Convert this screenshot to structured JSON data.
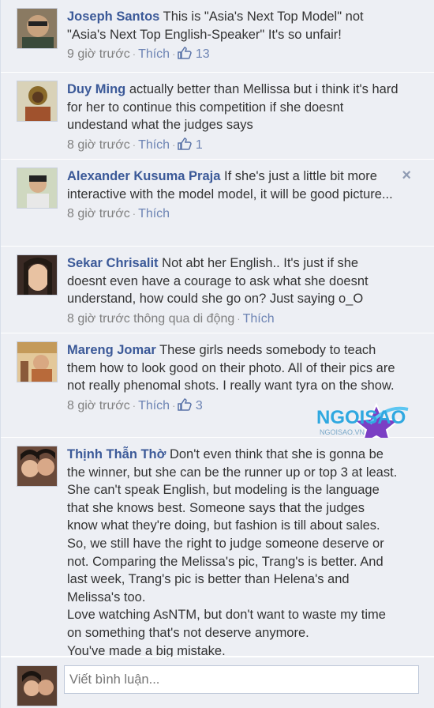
{
  "comments": [
    {
      "author": "Joseph Santos",
      "text": "This is \"Asia's Next Top Model\" not \"Asia's Next Top English-Speaker\" It's so unfair!",
      "time": "9 giờ trước",
      "like_label": "Thích",
      "likes": "13"
    },
    {
      "author": "Duy Ming",
      "text": "actually better than Mellissa but i think it's hard for her to continue this competition if she doesnt undestand what the judges says",
      "time": "8 giờ trước",
      "like_label": "Thích",
      "likes": "1"
    },
    {
      "author": "Alexander Kusuma Praja",
      "text": "If she's just a little bit more interactive with the model model, it will be good picture...",
      "time": "8 giờ trước",
      "like_label": "Thích",
      "close_symbol": "×"
    },
    {
      "author": "Sekar Chrisalit",
      "text": "Not abt her English.. It's just if she doesnt even have a courage to ask what she doesnt understand, how could she go on? Just saying o_O",
      "time": "8 giờ trước thông qua di động",
      "like_label": "Thích"
    },
    {
      "author": "Mareng Jomar",
      "text": "These girls needs somebody to teach them how to look good on their photo. All of their pics are not really phenomal shots. I really want tyra on the show.",
      "time": "8 giờ trước",
      "like_label": "Thích",
      "likes": "3"
    },
    {
      "author": "Thịnh Thẫn Thờ",
      "text": "Don't even think that she is gonna be the winner, but she can be the runner up or top 3 at least. She can't speak English, but modeling is the language that she knows best. Someone says that the judges know what they're doing, but fashion is till about sales. So, we still have the right to judge someone deserve or not. Comparing the Melissa's pic, Trang's is better. And last week, Trang's pic is better than Helena's and Melissa's too.",
      "text2": "Love watching AsNTM, but don't want to waste my time on something that's not deserve anymore.",
      "text3": "You've made a big mistake."
    }
  ],
  "watermark": {
    "brand": "NGOISAO",
    "url": "NGOISAO.VN"
  },
  "composer": {
    "placeholder": "Viết bình luận..."
  },
  "colors": {
    "link": "#3b5998",
    "meta": "#808080",
    "background": "#edeff4"
  },
  "icons": {
    "like": "thumbs-up-icon",
    "close": "close-icon",
    "star": "star-icon"
  }
}
